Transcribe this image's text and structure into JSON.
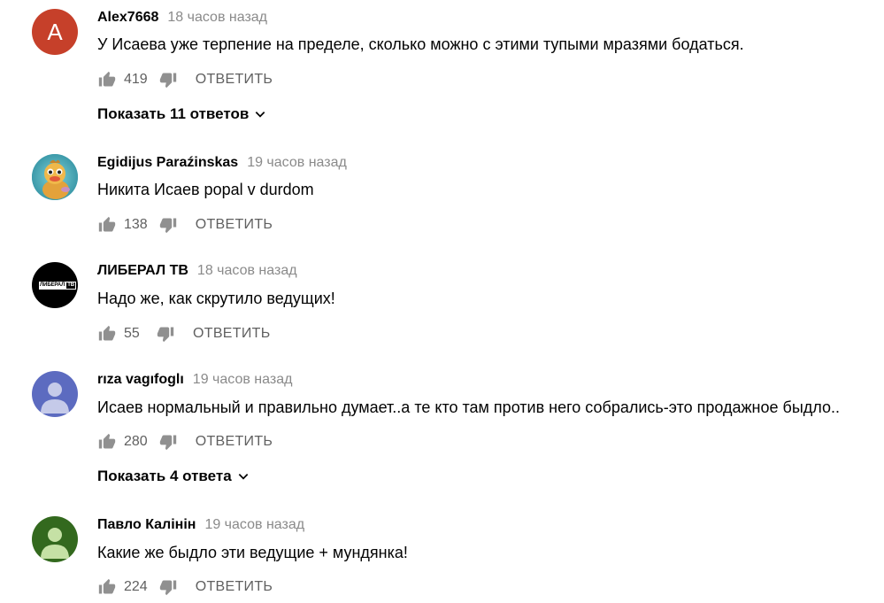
{
  "comments": [
    {
      "author": "Alex7668",
      "time": "18 часов назад",
      "text": "У Исаева уже терпение на пределе, сколько можно с этими тупыми  мразями бодаться.",
      "likes": "419",
      "reply_label": "ОТВЕТИТЬ",
      "avatar_letter": "A",
      "replies_label": "Показать 11 ответов"
    },
    {
      "author": "Egidijus Paraźinskas",
      "time": "19 часов назад",
      "text": "Никита Исаев popal v durdom",
      "likes": "138",
      "reply_label": "ОТВЕТИТЬ"
    },
    {
      "author": "ЛИБЕРАЛ ТВ",
      "time": "18 часов назад",
      "text": "Надо же, как скрутило ведущих!",
      "likes": "55",
      "reply_label": "ОТВЕТИТЬ",
      "avatar_logo_text_1": "ЛИБЕРАЛ",
      "avatar_logo_text_2": "ТВ"
    },
    {
      "author": "rıza vagıfoglı",
      "time": "19 часов назад",
      "text": "Исаев нормальный и правильно думает..а те кто там против него собрались-это продажное быдло..",
      "likes": "280",
      "reply_label": "ОТВЕТИТЬ",
      "replies_label": "Показать 4 ответа"
    },
    {
      "author": "Павло Калінін",
      "time": "19 часов назад",
      "text": "Какие же быдло эти ведущие + мундянка!",
      "likes": "224",
      "reply_label": "ОТВЕТИТЬ"
    }
  ],
  "icons": {
    "like": "thumb-up-icon",
    "dislike": "thumb-down-icon",
    "expand": "chevron-down-icon"
  },
  "colors": {
    "text_primary": "#030303",
    "text_secondary": "#606060",
    "timestamp": "#8a8a8a",
    "avatar_red": "#c6402a",
    "avatar_purple": "#5c6bc0",
    "avatar_green": "#33691e"
  }
}
